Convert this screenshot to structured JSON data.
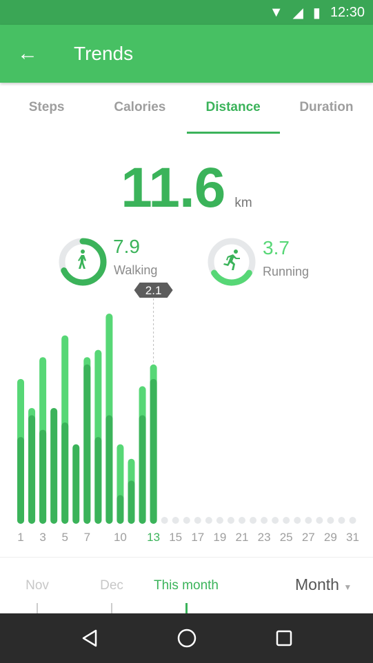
{
  "status": {
    "time": "12:30"
  },
  "header": {
    "title": "Trends",
    "back_icon": "arrow-left-icon"
  },
  "tabs": [
    {
      "label": "Steps"
    },
    {
      "label": "Calories"
    },
    {
      "label": "Distance",
      "active": true
    },
    {
      "label": "Duration"
    }
  ],
  "summary": {
    "total": "11.6",
    "unit": "km",
    "walking": {
      "value": "7.9",
      "label": "Walking",
      "fraction": 0.68
    },
    "running": {
      "value": "3.7",
      "label": "Running",
      "fraction": 0.32
    }
  },
  "colors": {
    "primary": "#47c063",
    "walking": "#3bb35a",
    "running": "#57d776",
    "empty": "#e6e8ea"
  },
  "chart_data": {
    "type": "bar",
    "stacked": true,
    "categories": [
      1,
      2,
      3,
      4,
      5,
      6,
      7,
      8,
      9,
      10,
      11,
      12,
      13,
      14,
      15,
      16,
      17,
      18,
      19,
      20,
      21,
      22,
      23,
      24,
      25,
      26,
      27,
      28,
      29,
      30,
      31
    ],
    "tick_labels": [
      "1",
      "3",
      "5",
      "7",
      "10",
      "13",
      "15",
      "17",
      "19",
      "21",
      "23",
      "25",
      "27",
      "29",
      "31"
    ],
    "tick_days": [
      1,
      3,
      5,
      7,
      10,
      13,
      15,
      17,
      19,
      21,
      23,
      25,
      27,
      29,
      31
    ],
    "highlight_day": 13,
    "tooltip": "2.1",
    "series": [
      {
        "name": "Walking",
        "values": [
          1.1,
          1.4,
          1.2,
          1.5,
          1.3,
          1.0,
          2.1,
          1.1,
          1.4,
          0.3,
          0.5,
          1.4,
          1.9
        ]
      },
      {
        "name": "Running",
        "values": [
          0.8,
          0.1,
          1.0,
          0.0,
          1.2,
          0.0,
          0.1,
          1.2,
          1.4,
          0.7,
          0.3,
          0.4,
          0.2
        ]
      }
    ],
    "ylim": [
      0,
      3
    ]
  },
  "periods": [
    {
      "label": "Nov"
    },
    {
      "label": "Dec"
    },
    {
      "label": "This month",
      "active": true
    }
  ],
  "range_select": {
    "value": "Month"
  }
}
